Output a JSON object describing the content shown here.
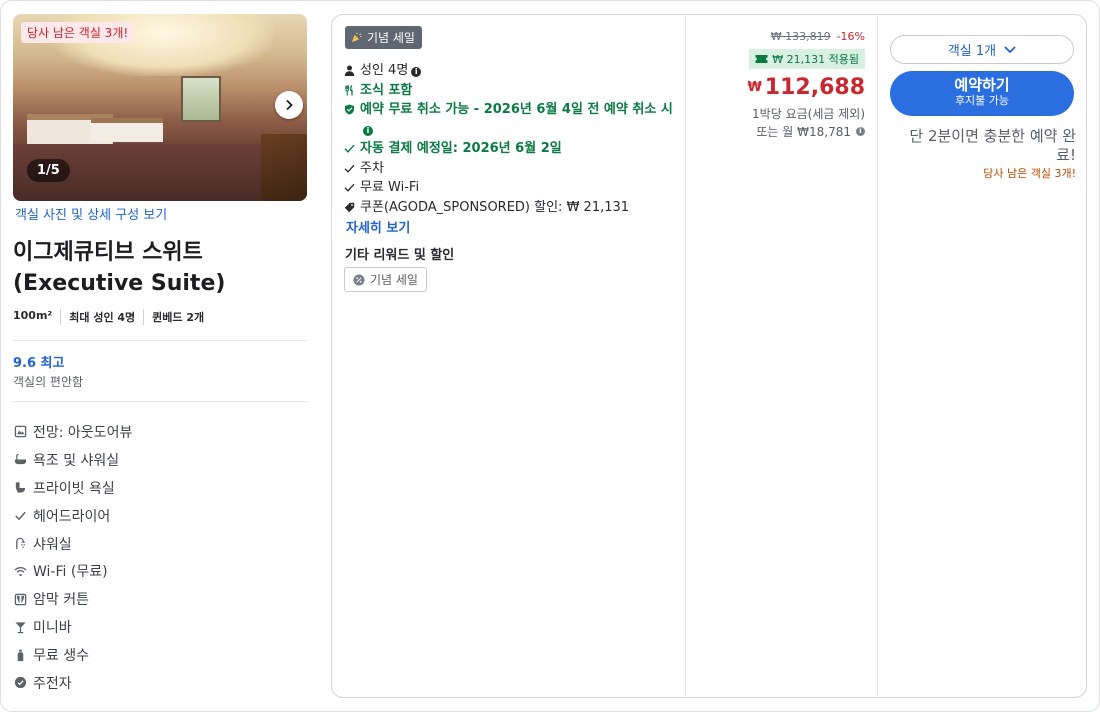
{
  "room": {
    "photo_badge": "당사 남은 객실 3개!",
    "photo_counter": "1/5",
    "photo_link": "객실 사진 및 상세 구성 보기",
    "title_line1": "이그제큐티브 스위트",
    "title_line2": "(Executive Suite)",
    "specs": [
      "100m²",
      "최대 성인 4명",
      "퀸베드 2개"
    ],
    "score": "9.6 최고",
    "score_label": "객실의 편안함",
    "amenities": [
      {
        "icon": "view-icon",
        "label": "전망: 아웃도어뷰"
      },
      {
        "icon": "bathtub-icon",
        "label": "욕조 및 샤워실"
      },
      {
        "icon": "bath-icon",
        "label": "프라이빗 욕실"
      },
      {
        "icon": "check-icon",
        "label": "헤어드라이어"
      },
      {
        "icon": "shower-icon",
        "label": "샤워실"
      },
      {
        "icon": "wifi-icon",
        "label": "Wi-Fi (무료)"
      },
      {
        "icon": "curtain-icon",
        "label": "암막 커튼"
      },
      {
        "icon": "minibar-icon",
        "label": "미니바"
      },
      {
        "icon": "water-bottle-icon",
        "label": "무료 생수"
      },
      {
        "icon": "kettle-icon",
        "label": "주전자"
      }
    ]
  },
  "offer": {
    "sale_tag": "기념 세일",
    "features": [
      {
        "icon": "person-icon",
        "text": "성인 4명",
        "style": "plain",
        "info": true
      },
      {
        "icon": "utensils-icon",
        "text": "조식 포함",
        "style": "green",
        "info": false
      },
      {
        "icon": "shield-icon",
        "text": "예약 무료 취소 가능 - 2026년 6월 4일 전 예약 취소 시",
        "style": "green",
        "info": true
      },
      {
        "icon": "check-icon",
        "text": "자동 결제 예정일: 2026년 6월 2일",
        "style": "green",
        "info": false
      },
      {
        "icon": "check-icon",
        "text": "주차",
        "style": "plain",
        "info": false
      },
      {
        "icon": "check-icon",
        "text": "무료 Wi-Fi",
        "style": "plain",
        "info": false
      },
      {
        "icon": "tag-icon",
        "text": "쿠폰(AGODA_SPONSORED) 할인: ₩ 21,131",
        "style": "plain",
        "info": false
      }
    ],
    "more_link": "자세히 보기",
    "other_heading": "기타 리워드 및 할인",
    "other_tag": "기념 세일"
  },
  "price": {
    "original": "₩ 133,819",
    "discount_pct": "-16%",
    "applied": "₩ 21,131 적용됨",
    "currency": "₩",
    "amount": "112,688",
    "per_night": "1박당 요금(세금 제외)",
    "monthly": "또는 월 ₩18,781"
  },
  "booking": {
    "room_select": "객실 1개",
    "book_label": "예약하기",
    "book_sub": "후지불 가능",
    "urgency": "단 2분이면 충분한 예약 완료!",
    "urgency_sub": "당사 남은 객실 3개!"
  },
  "colors": {
    "accent_blue": "#2a6ee0",
    "link_blue": "#2163d3",
    "price_red": "#c7272e",
    "green": "#0a7a42"
  }
}
